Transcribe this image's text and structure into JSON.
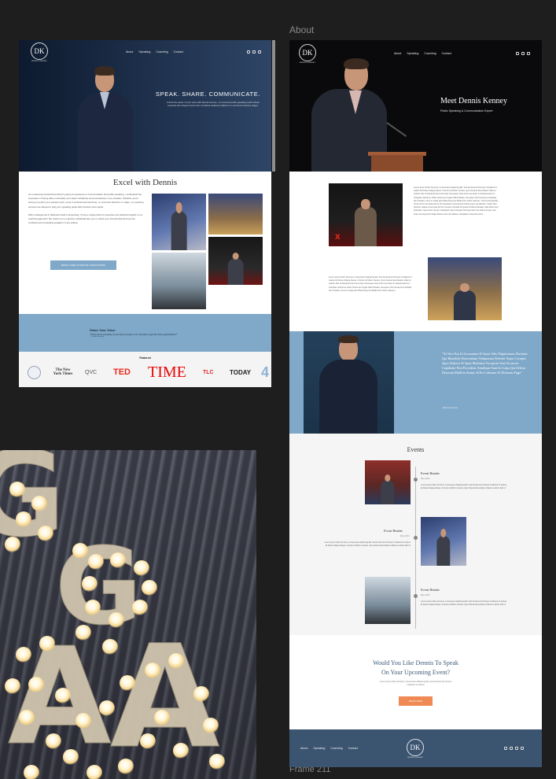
{
  "canvas": {
    "about_label": "About",
    "frame_label": "Frame 211"
  },
  "home": {
    "logo_text": "DK",
    "logo_sub": "DENNIS KENNEY",
    "nav": [
      "About",
      "Speaking",
      "Coaching",
      "Contact"
    ],
    "hero_headline": "SPEAK. SHARE. COMMUNICATE.",
    "hero_sub": "Unlock the power of your voice with Dennis Kenney - A renowned public speaking coach whose expertise has shaped voices from countless academic platforms to prominent industry stages.",
    "excel_title": "Excel with Dennis",
    "excel_paragraph_1": "As a seasoned professional with [X years] of experience in communication and public speaking, I understand the importance of being able to articulate your ideas confidently and persuasively in any situation. Whether you're aiming to perfect your elevator pitch, excel in professional interviews, or command attention on stage, my coaching services are tailored to help your speaking goals with precision and impact.",
    "excel_paragraph_2": "With a background in [Relevant Field or Expertise], I bring a unique blend of expertise and practical insights to my coaching approach. My mission is to empower individuals like you to unlock your full potential and become confident and compelling speakers in any setting.",
    "cta_label": "BOOK A FREE 15 MINUTE CONSULTATION",
    "voice_title": "Share Your Voice",
    "voice_quote": "\"If they know someday, do we have enough in our narrative to get the future generations?\"",
    "voice_author": "— Dennis Kenney",
    "featured_title": "Featured",
    "featured_logos": [
      "seal",
      "The New York Times",
      "QVC",
      "TED",
      "TIME",
      "TLC",
      "TODAY",
      "4"
    ]
  },
  "about": {
    "logo_text": "DK",
    "logo_sub": "DENNIS KENNEY",
    "nav": [
      "About",
      "Speaking",
      "Coaching",
      "Contact"
    ],
    "hero_title": "Meet Dennis Kenney",
    "hero_subtitle": "Public Speaking & Communication Expert",
    "bio_1": "Lorem Ipsum Dolor Sit Amet, Consectetur Adipiscing Elit. Sed Do Eiusmod Tempor Incididunt Ut Labore Et Dolore Magna Aliqua. Ut Enim Ad Minim Veniam, Quis Nostrud Exercitation Ullamco Laboris Nisi Ut Aliquip Ex Ea Commodo Consequat. Duis Aute Irure Dolor In Reprehenderit In Voluptate Velit Esse Cillum Dolore Eu Fugiat Nulla Pariatur. Excepteur Sint Occaecat Cupidatat Non Proident, Sunt In Culpa Qui Officia Deserunt Mollit Anim Id Est Laborum. Sed Ut Perspiciatis Unde Omnis Iste Natus Error Sit Voluptatem Accusantium Doloremque Laudantium, Totam Rem Aperiam, Eaque Ipsa Quae Ab Illo Inventore Veritatis Et Quasi Architecto Beatae Vitae Dicta Sunt Explicabo. Nemo Enim Ipsam Voluptatem Quia Voluptas Sit Aspernatur Aut Odit Aut Fugit, Sed Quia Consequuntur Magni Dolores Eos Qui Ratione Voluptatem Sequi Nesciunt.",
    "bio_2": "Lorem Ipsum Dolor Sit Amet, Consectetur Adipiscing Elit. Sed Do Eiusmod Tempor Incididunt Ut Labore Et Dolore Magna Aliqua. Ut Enim Ad Minim Veniam, Quis Nostrud Exercitation Ullamco Laboris Nisi Ut Aliquip Ex Ea Commodo Consequat. Duis Aute Irure Dolor In Reprehenderit In Voluptate Velit Esse Cillum Dolore Eu Fugiat Nulla Pariatur. Excepteur Sint Occaecat Cupidatat Non Proident, Sunt In Culpa Qui Officia Deserunt Mollit Anim Id Est Laborum.",
    "quote_text": "\"At Vero Eos Et Accusamus Et Iusto Odio Dignissimos Ducimus Qui Blanditiis Praesentium Voluptatum Deleniti Atque Corrupti Quos Dolores Et Quas Molestias Excepturi Sint Occaecati Cupiditate Non Provident, Similique Sunt In Culpa Qui Officia Deserunt Mollitia Animi, Id Est Laborum Et Dolorum Fuga\"",
    "quote_author": "-Dennis Kenney",
    "events_title": "Events",
    "events": [
      {
        "header": "Event Header",
        "date": "May 2024",
        "text": "Lorem Ipsum Dolor Sit Amet, Consectetur Adipiscing Elit. Sed Do Eiusmod Tempor Incididunt Ut Labore Et Dolore Magna Aliqua. Ut Enim Ad Minim Veniam, Quis Nostrud Exercitation Ullamco Laboris Nisi Ut"
      },
      {
        "header": "Event Header",
        "date": "May 2024",
        "text": "Lorem Ipsum Dolor Sit Amet, Consectetur Adipiscing Elit. Sed Do Eiusmod Tempor Incididunt Ut Labore Et Dolore Magna Aliqua. Ut Enim Ad Minim Veniam, Quis Nostrud Exercitation Ullamco Laboris Nisi Ut"
      },
      {
        "header": "Event Header",
        "date": "May 2024",
        "text": "Lorem Ipsum Dolor Sit Amet, Consectetur Adipiscing Elit. Sed Do Eiusmod Tempor Incididunt Ut Labore Et Dolore Magna Aliqua. Ut Enim Ad Minim Veniam, Quis Nostrud Exercitation Ullamco Laboris Nisi Ut"
      }
    ],
    "book_title_1": "Would You Like Dennis To Speak",
    "book_title_2": "On Your Upcoming Event?",
    "book_sub": "Lorem Ipsum Dolor Sit Amet, Consectetur Adipiscing Elit. Sed Do Eiusmod Tempor Incididunt Ut Labore",
    "book_button": "BOOK NOW",
    "footer_nav": [
      "About",
      "Speaking",
      "Coaching",
      "Contact"
    ]
  },
  "colors": {
    "accent_blue": "#7fa8c9",
    "cta_orange": "#f08a55",
    "footer_navy": "#3b5470",
    "canvas_bg": "#1e1e1e"
  },
  "icons": {
    "social": [
      "instagram-icon",
      "facebook-icon",
      "x-icon",
      "youtube-icon"
    ]
  }
}
